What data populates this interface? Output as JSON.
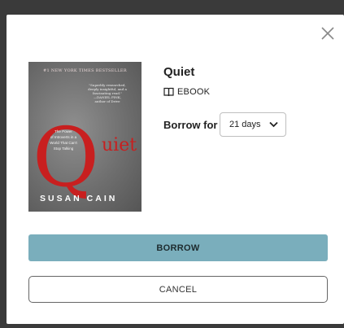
{
  "dialog": {
    "close_icon": "close-icon"
  },
  "book": {
    "title": "Quiet",
    "format_icon": "book-icon",
    "format_label": "EBOOK",
    "cover": {
      "banner": "#1 NEW YORK TIMES BESTSELLER",
      "quote_line1": "\"Superbly researched,",
      "quote_line2": "deeply insightful, and a fascinating read.\"",
      "quote_source": "—DANIEL PINK,",
      "quote_source2": "author of Drive",
      "big_letter": "Q",
      "rest_of_title": "uiet",
      "subtitle_line1": "The Power",
      "subtitle_line2": "of Introverts in a",
      "subtitle_line3": "World That Can't",
      "subtitle_line4": "Stop Talking",
      "author": "SUSAN CAIN",
      "colors": {
        "title_red": "#c81f1f"
      }
    }
  },
  "borrow": {
    "label": "Borrow for",
    "selected_option": "21 days",
    "chevron_icon": "chevron-down-icon"
  },
  "actions": {
    "borrow_label": "BORROW",
    "cancel_label": "CANCEL",
    "borrow_color": "#7aaebc"
  }
}
